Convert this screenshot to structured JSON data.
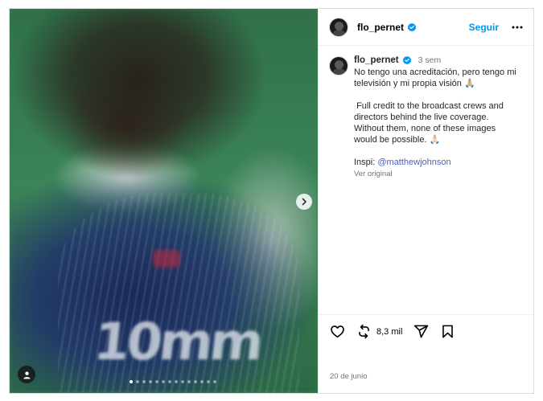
{
  "post": {
    "author": "flo_pernet",
    "follow_label": "Seguir",
    "caption": {
      "time": "3 sem",
      "line1": "No tengo una acreditación, pero tengo mi televisión y mi propia visión 🙏🏼",
      "line2": " Full credit to the broadcast crews and directors behind the live coverage. Without them, none of these images would be possible. 🙏🏻",
      "inspi_prefix": "Inspi: ",
      "inspi_mention": "@matthewjohnson",
      "see_original": "Ver original"
    },
    "media": {
      "jersey_text": "10mm",
      "dots_total": 14,
      "active_dot": 1
    },
    "actions": {
      "repost_count": "8,3 mil"
    },
    "date": "20 de junio"
  },
  "colors": {
    "accent": "#0095f6",
    "verified": "#0095f6",
    "mention": "#4861c5",
    "muted": "#737373"
  },
  "icons": [
    "chevron-right-icon",
    "user-tag-icon",
    "verified-icon",
    "more-icon",
    "heart-icon",
    "repost-icon",
    "share-icon",
    "bookmark-icon"
  ]
}
